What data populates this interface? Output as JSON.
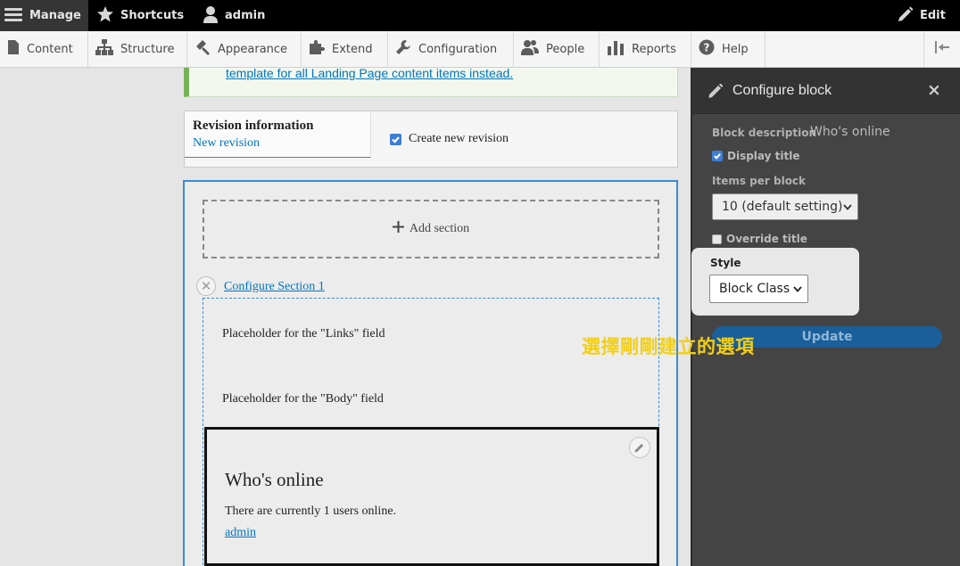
{
  "toolbar": {
    "manage_label": "Manage",
    "shortcuts_label": "Shortcuts",
    "user_label": "admin",
    "edit_label": "Edit"
  },
  "tray": {
    "items": [
      {
        "label": "Content",
        "icon": "document-icon"
      },
      {
        "label": "Structure",
        "icon": "sitemap-icon"
      },
      {
        "label": "Appearance",
        "icon": "paint-icon"
      },
      {
        "label": "Extend",
        "icon": "puzzle-icon"
      },
      {
        "label": "Configuration",
        "icon": "wrench-icon"
      },
      {
        "label": "People",
        "icon": "people-icon"
      },
      {
        "label": "Reports",
        "icon": "bar-chart-icon"
      },
      {
        "label": "Help",
        "icon": "help-icon"
      }
    ]
  },
  "main": {
    "message_link": "template for all Landing Page content items instead.",
    "revision": {
      "title": "Revision information",
      "subtitle": "New revision",
      "checkbox_label": "Create new revision"
    },
    "layout": {
      "add_section": "Add section",
      "configure_section": "Configure Section 1",
      "placeholder_links": "Placeholder for the \"Links\" field",
      "placeholder_body": "Placeholder for the \"Body\" field",
      "block_title": "Who's online",
      "block_text": "There are currently 1 users online.",
      "block_link": "admin"
    }
  },
  "dialog": {
    "title": "Configure block",
    "close_symbol": "×",
    "block_description_label": "Block description",
    "block_description_value": "Who's online",
    "display_title_label": "Display title",
    "items_per_block_label": "Items per block",
    "items_per_block_value": "10 (default setting)",
    "override_title_label": "Override title",
    "update_label": "Update",
    "style_label": "Style",
    "style_value": "Block Class"
  },
  "annotation": "選擇剛剛建立的選項",
  "colors": {
    "accent": "#3b8bd4",
    "link": "#0074bd",
    "annotation": "#f2cf17",
    "dialog_bg": "#444444",
    "update_button": "#1a5f99"
  }
}
